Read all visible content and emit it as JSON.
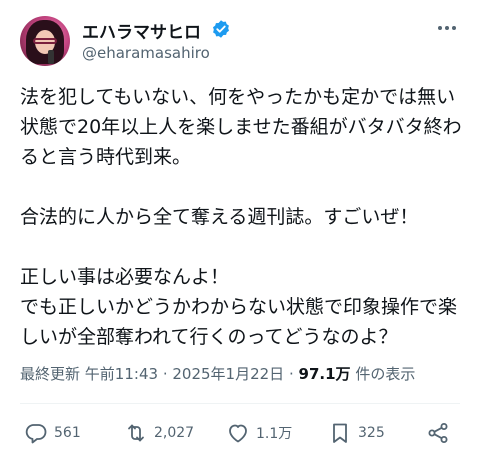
{
  "author": {
    "display_name": "エハラマサヒロ",
    "handle": "@eharamasahiro",
    "verified_color": "#1d9bf0"
  },
  "tweet": {
    "paragraphs": [
      [
        "法を犯してもいない、何をやったかも定かでは無い",
        "状態で20年以上人を楽しませた番組がバタバタ終わ",
        "ると言う時代到来。"
      ],
      [
        "合法的に人から全て奪える週刊誌。すごいぜ！"
      ],
      [
        "正しい事は必要なんよ！",
        "でも正しいかどうかわからない状態で印象操作で楽",
        "しいが全部奪われて行くのってどうなのよ？"
      ]
    ]
  },
  "meta": {
    "prefix": "最終更新",
    "time": "午前11:43",
    "separator": "·",
    "date": "2025年1月22日",
    "views_count": "97.1万",
    "views_label": "件の表示"
  },
  "actions": {
    "reply_count": "561",
    "retweet_count": "2,027",
    "like_count": "1.1万",
    "bookmark_count": "325"
  },
  "icons": {
    "reply": "reply-icon",
    "retweet": "retweet-icon",
    "like": "heart-icon",
    "bookmark": "bookmark-icon",
    "share": "share-icon",
    "more": "more-dots-icon",
    "verified": "verified-badge-icon"
  }
}
